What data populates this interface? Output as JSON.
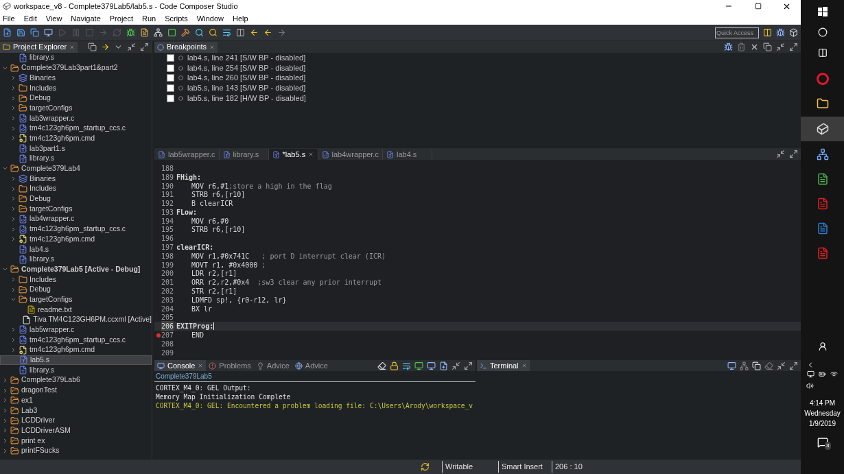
{
  "window": {
    "title": "workspace_v8 - Complete379Lab5/lab5.s - Code Composer Studio"
  },
  "menu": [
    "File",
    "Edit",
    "View",
    "Navigate",
    "Project",
    "Run",
    "Scripts",
    "Window",
    "Help"
  ],
  "quick_access": {
    "placeholder": "Quick Access"
  },
  "project_explorer": {
    "tab": {
      "label": "Project Explorer",
      "selected": true
    },
    "scrolled_parent_children": [
      {
        "label": "library.s",
        "kind": "s-file",
        "selected": false
      }
    ],
    "items": [
      {
        "label": "Complete379Lab3part1&part2",
        "kind": "project",
        "expanded": true,
        "selected": false,
        "active": false,
        "children": [
          {
            "label": "Binaries",
            "kind": "binaries",
            "expanded": false,
            "selected": false
          },
          {
            "label": "Includes",
            "kind": "includes",
            "expanded": false,
            "selected": false
          },
          {
            "label": "Debug",
            "kind": "folder",
            "expanded": false,
            "selected": false
          },
          {
            "label": "targetConfigs",
            "kind": "folder",
            "expanded": false,
            "selected": false
          },
          {
            "label": "lab3wrapper.c",
            "kind": "c-file",
            "expanded": false,
            "selected": false
          },
          {
            "label": "tm4c123gh6pm_startup_ccs.c",
            "kind": "c-file",
            "expanded": false,
            "selected": false
          },
          {
            "label": "tm4c123gh6pm.cmd",
            "kind": "cmd-file",
            "expanded": false,
            "selected": false
          },
          {
            "label": "lab3part1.s",
            "kind": "s-file",
            "selected": false
          },
          {
            "label": "library.s",
            "kind": "s-file",
            "selected": false
          }
        ]
      },
      {
        "label": "Complete379Lab4",
        "kind": "project",
        "expanded": true,
        "selected": false,
        "active": false,
        "children": [
          {
            "label": "Binaries",
            "kind": "binaries",
            "expanded": false,
            "selected": false
          },
          {
            "label": "Includes",
            "kind": "includes",
            "expanded": false,
            "selected": false
          },
          {
            "label": "Debug",
            "kind": "folder",
            "expanded": false,
            "selected": false
          },
          {
            "label": "targetConfigs",
            "kind": "folder",
            "expanded": false,
            "selected": false
          },
          {
            "label": "lab4wrapper.c",
            "kind": "c-file",
            "expanded": false,
            "selected": false
          },
          {
            "label": "tm4c123gh6pm_startup_ccs.c",
            "kind": "c-file",
            "expanded": false,
            "selected": false
          },
          {
            "label": "tm4c123gh6pm.cmd",
            "kind": "cmd-file",
            "expanded": false,
            "selected": false
          },
          {
            "label": "lab4.s",
            "kind": "s-file",
            "selected": false
          },
          {
            "label": "library.s",
            "kind": "s-file",
            "selected": false
          }
        ]
      },
      {
        "label": "Complete379Lab5  [Active - Debug]",
        "kind": "project",
        "expanded": true,
        "selected": false,
        "active": true,
        "children": [
          {
            "label": "Includes",
            "kind": "includes",
            "expanded": false,
            "selected": false
          },
          {
            "label": "Debug",
            "kind": "folder",
            "expanded": false,
            "selected": false
          },
          {
            "label": "targetConfigs",
            "kind": "folder",
            "expanded": true,
            "selected": false,
            "children": [
              {
                "label": "readme.txt",
                "kind": "txt-file",
                "selected": false
              },
              {
                "label": "Tiva TM4C123GH6PM.ccxml [Active]",
                "kind": "ccxml-file",
                "selected": false
              }
            ]
          },
          {
            "label": "lab5wrapper.c",
            "kind": "c-file",
            "expanded": false,
            "selected": false
          },
          {
            "label": "tm4c123gh6pm_startup_ccs.c",
            "kind": "c-file",
            "expanded": false,
            "selected": false
          },
          {
            "label": "tm4c123gh6pm.cmd",
            "kind": "cmd-file",
            "expanded": false,
            "selected": false
          },
          {
            "label": "lab5.s",
            "kind": "s-file",
            "selected": true
          },
          {
            "label": "library.s",
            "kind": "s-file",
            "selected": false
          }
        ]
      },
      {
        "label": "Complete379Lab6",
        "kind": "project",
        "expanded": false,
        "selected": false,
        "active": false
      },
      {
        "label": "dragonTest",
        "kind": "project",
        "expanded": false,
        "selected": false,
        "active": false
      },
      {
        "label": "ex1",
        "kind": "project",
        "expanded": false,
        "selected": false,
        "active": false
      },
      {
        "label": "Lab3",
        "kind": "project",
        "expanded": false,
        "selected": false,
        "active": false
      },
      {
        "label": "LCDDriver",
        "kind": "project",
        "expanded": false,
        "selected": false,
        "active": false
      },
      {
        "label": "LCDDriverASM",
        "kind": "project",
        "expanded": false,
        "selected": false,
        "active": false
      },
      {
        "label": "print ex",
        "kind": "project",
        "expanded": false,
        "selected": false,
        "active": false
      },
      {
        "label": "printFSucks",
        "kind": "project",
        "expanded": false,
        "selected": false,
        "active": false
      }
    ]
  },
  "breakpoints": {
    "tab": {
      "label": "Breakpoints",
      "selected": true
    },
    "items": [
      {
        "label": "lab4.s, line 241 [S/W BP - disabled]",
        "checked": false
      },
      {
        "label": "lab4.s, line 254 [S/W BP - disabled]",
        "checked": false
      },
      {
        "label": "lab4.s, line 260 [S/W BP - disabled]",
        "checked": false
      },
      {
        "label": "lab5.s, line 143 [S/W BP - disabled]",
        "checked": false
      },
      {
        "label": "lab5.s, line 182 [H/W BP - disabled]",
        "checked": false
      }
    ]
  },
  "editor": {
    "tabs": [
      {
        "label": "lab5wrapper.c",
        "kind": "c-file",
        "selected": false
      },
      {
        "label": "library.s",
        "kind": "s-file",
        "selected": false
      },
      {
        "label": "*lab5.s",
        "kind": "s-file",
        "selected": true
      },
      {
        "label": "lab4wrapper.c",
        "kind": "c-file",
        "selected": false
      },
      {
        "label": "lab4.s",
        "kind": "s-file",
        "selected": false
      }
    ],
    "lines": [
      {
        "number": "188",
        "kind": "blank",
        "current": false,
        "breakpoint": false
      },
      {
        "number": "189",
        "kind": "label",
        "code": "FHigh:",
        "current": false,
        "breakpoint": false
      },
      {
        "number": "190",
        "kind": "code",
        "code": "MOV r6,#1",
        "comment": ";store a high in the flag",
        "current": false,
        "breakpoint": false
      },
      {
        "number": "191",
        "kind": "code",
        "code": "STRB r6,[r10]",
        "current": false,
        "breakpoint": false
      },
      {
        "number": "192",
        "kind": "code",
        "code": "B clearICR",
        "current": false,
        "breakpoint": false
      },
      {
        "number": "193",
        "kind": "label",
        "code": "FLow:",
        "current": false,
        "breakpoint": false
      },
      {
        "number": "194",
        "kind": "code",
        "code": "MOV r6,#0",
        "current": false,
        "breakpoint": false
      },
      {
        "number": "195",
        "kind": "code",
        "code": "STRB r6,[r10]",
        "current": false,
        "breakpoint": false
      },
      {
        "number": "196",
        "kind": "blank",
        "current": false,
        "breakpoint": false
      },
      {
        "number": "197",
        "kind": "label",
        "code": "clearICR:",
        "current": false,
        "breakpoint": false
      },
      {
        "number": "198",
        "kind": "code",
        "code": "MOV r1,#0x741C   ",
        "comment": "; port D interrupt clear (ICR)",
        "current": false,
        "breakpoint": false
      },
      {
        "number": "199",
        "kind": "code",
        "code": "MOVT r1, #0x4000 ",
        "comment": ";",
        "current": false,
        "breakpoint": false
      },
      {
        "number": "200",
        "kind": "code",
        "code": "LDR r2,[r1]",
        "current": false,
        "breakpoint": false
      },
      {
        "number": "201",
        "kind": "code",
        "code": "ORR r2,r2,#0x4  ",
        "comment": ";sw3 clear any prior interrupt",
        "current": false,
        "breakpoint": false
      },
      {
        "number": "202",
        "kind": "code",
        "code": "STR r2,[r1]",
        "current": false,
        "breakpoint": false
      },
      {
        "number": "203",
        "kind": "code",
        "code": "LDMFD sp!, {r0-r12, lr}",
        "current": false,
        "breakpoint": false
      },
      {
        "number": "204",
        "kind": "code",
        "code": "BX lr",
        "current": false,
        "breakpoint": false
      },
      {
        "number": "205",
        "kind": "blank",
        "current": false,
        "breakpoint": false
      },
      {
        "number": "206",
        "kind": "label",
        "code": "EXITProg:",
        "current": true,
        "breakpoint": false
      },
      {
        "number": "207",
        "kind": "code",
        "code": "END",
        "current": false,
        "breakpoint": true
      },
      {
        "number": "208",
        "kind": "blank",
        "current": false,
        "breakpoint": false
      },
      {
        "number": "209",
        "kind": "blank",
        "current": false,
        "breakpoint": false
      }
    ]
  },
  "console": {
    "tabs": [
      {
        "label": "Console",
        "kind": "console",
        "selected": true
      },
      {
        "label": "Problems",
        "kind": "problems",
        "selected": false
      },
      {
        "label": "Advice",
        "kind": "advice",
        "selected": false
      },
      {
        "label": "Advice",
        "kind": "globe",
        "selected": false
      }
    ],
    "source": "Complete379Lab5",
    "lines": [
      {
        "text": "CORTEX_M4_0: GEL Output:",
        "kind": "output"
      },
      {
        "text": "Memory Map Initialization Complete",
        "kind": "output"
      },
      {
        "text": "CORTEX_M4_0: GEL: Encountered a problem loading file: C:\\Users\\Arody\\workspace_v",
        "kind": "warning"
      }
    ]
  },
  "terminal": {
    "tab": {
      "label": "Terminal",
      "selected": true
    }
  },
  "status_bar": {
    "mode": "Writable",
    "insert": "Smart Insert",
    "position": "206 : 10"
  },
  "taskbar": {
    "time": "4:14 PM",
    "day": "Wednesday",
    "date": "1/9/2019",
    "notifications": "3"
  }
}
